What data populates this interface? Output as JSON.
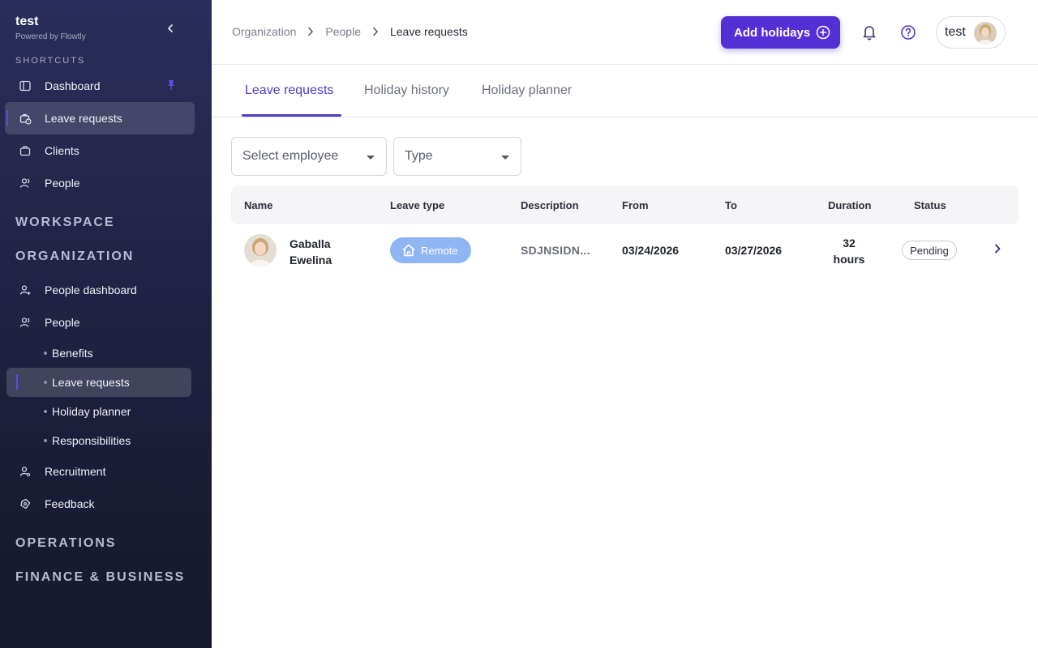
{
  "sidebar": {
    "brand_name": "test",
    "brand_sub": "Powered by Flowtly",
    "shortcuts_title": "SHORTCUTS",
    "shortcuts": [
      {
        "label": "Dashboard",
        "icon": "sidebar-panel-icon"
      },
      {
        "label": "Leave requests",
        "icon": "briefcase-clock-icon"
      },
      {
        "label": "Clients",
        "icon": "briefcase-icon"
      },
      {
        "label": "People",
        "icon": "users-icon"
      }
    ],
    "workspace_title": "WORKSPACE",
    "organization_title": "ORGANIZATION",
    "org_items": [
      {
        "label": "People dashboard",
        "icon": "user-plus-icon"
      },
      {
        "label": "People",
        "icon": "users-icon"
      }
    ],
    "people_sub": [
      "Benefits",
      "Leave requests",
      "Holiday planner",
      "Responsibilities"
    ],
    "org_items_after": [
      {
        "label": "Recruitment",
        "icon": "user-search-icon"
      },
      {
        "label": "Feedback",
        "icon": "feedback-icon"
      }
    ],
    "operations_title": "OPERATIONS",
    "finance_title": "FINANCE & BUSINESS"
  },
  "header": {
    "breadcrumbs": [
      "Organization",
      "People",
      "Leave requests"
    ],
    "add_button": "Add holidays",
    "user_name": "test"
  },
  "tabs": [
    "Leave requests",
    "Holiday history",
    "Holiday planner"
  ],
  "filters": {
    "employee_placeholder": "Select employee",
    "type_placeholder": "Type"
  },
  "table": {
    "columns": [
      "Name",
      "Leave type",
      "Description",
      "From",
      "To",
      "Duration",
      "Status"
    ],
    "rows": [
      {
        "first_name": "Gaballa",
        "last_name": "Ewelina",
        "leave_type": "Remote",
        "description": "SDJNSIDN...",
        "from": "03/24/2026",
        "to": "03/27/2026",
        "duration_value": "32",
        "duration_unit": "hours",
        "status": "Pending"
      }
    ]
  },
  "colors": {
    "accent": "#5330d6",
    "sidebar_bg": "#232548",
    "remote_badge": "#8fb6f3"
  }
}
